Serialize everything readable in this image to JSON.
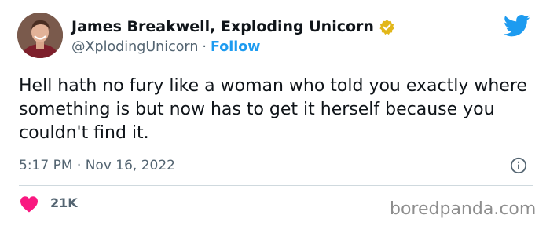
{
  "author": {
    "display_name": "James Breakwell, Exploding Unicorn",
    "handle": "@XplodingUnicorn",
    "separator": "·",
    "follow_label": "Follow",
    "verified_icon": "verified-badge-icon",
    "avatar_icon": "avatar"
  },
  "tweet": {
    "text": "Hell hath no fury like a woman who told you exactly where something is but now has to get it herself because you couldn't find it.",
    "timestamp": "5:17 PM · Nov 16, 2022"
  },
  "actions": {
    "like_icon": "heart-icon",
    "like_count": "21K",
    "info_icon": "info-icon"
  },
  "branding": {
    "platform_icon": "twitter-bird-icon",
    "watermark": "boredpanda.com"
  },
  "colors": {
    "accent": "#1d9bf0",
    "heart": "#f91880",
    "verified": "#e2b719",
    "secondary_text": "#536471"
  }
}
